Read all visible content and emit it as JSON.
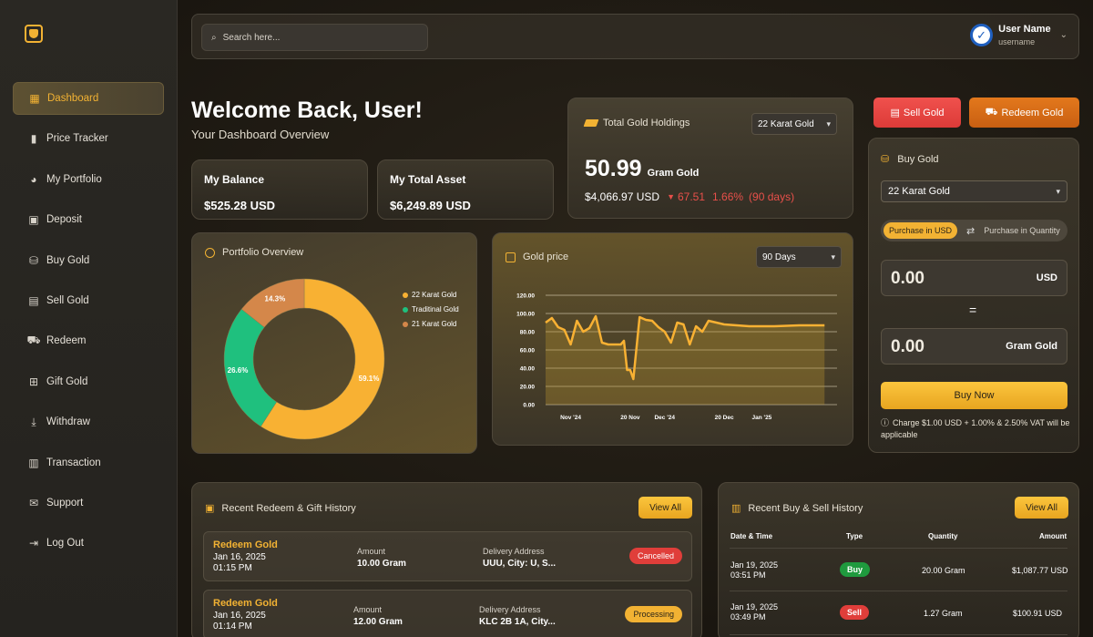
{
  "sidebar": {
    "items": [
      {
        "label": "Dashboard",
        "icon": "grid-icon",
        "glyph": "▦",
        "active": true
      },
      {
        "label": "Price Tracker",
        "icon": "bar-chart-icon",
        "glyph": "▮",
        "active": false
      },
      {
        "label": "My Portfolio",
        "icon": "pie-chart-icon",
        "glyph": "◕",
        "active": false
      },
      {
        "label": "Deposit",
        "icon": "deposit-icon",
        "glyph": "▣",
        "active": false
      },
      {
        "label": "Buy Gold",
        "icon": "cart-icon",
        "glyph": "⛁",
        "active": false
      },
      {
        "label": "Sell Gold",
        "icon": "sell-icon",
        "glyph": "▤",
        "active": false
      },
      {
        "label": "Redeem",
        "icon": "truck-icon",
        "glyph": "⛟",
        "active": false
      },
      {
        "label": "Gift Gold",
        "icon": "gift-icon",
        "glyph": "⊞",
        "active": false
      },
      {
        "label": "Withdraw",
        "icon": "withdraw-icon",
        "glyph": "⤓",
        "active": false
      },
      {
        "label": "Transaction",
        "icon": "receipt-icon",
        "glyph": "▥",
        "active": false
      },
      {
        "label": "Support",
        "icon": "mail-icon",
        "glyph": "✉",
        "active": false
      },
      {
        "label": "Log Out",
        "icon": "logout-icon",
        "glyph": "⇥",
        "active": false
      }
    ]
  },
  "topbar": {
    "search_placeholder": "Search here...",
    "user_name": "User Name",
    "user_handle": "username"
  },
  "welcome": {
    "title": "Welcome Back, User!",
    "subtitle": "Your Dashboard Overview"
  },
  "stats": {
    "balance_label": "My Balance",
    "balance_value": "$525.28 USD",
    "asset_label": "My Total Asset",
    "asset_value": "$6,249.89 USD"
  },
  "holdings": {
    "title": "Total Gold Holdings",
    "karat": "22 Karat Gold",
    "amount": "50.99",
    "unit": "Gram Gold",
    "usd": "$4,066.97 USD",
    "change": "67.51",
    "change_pct": "1.66%",
    "period": "(90 days)"
  },
  "actions": {
    "sell": "Sell Gold",
    "redeem": "Redeem Gold"
  },
  "buy": {
    "title": "Buy Gold",
    "karat": "22 Karat Gold",
    "toggle_on": "Purchase in USD",
    "toggle_off": "Purchase in Quantity",
    "usd_value": "0.00",
    "usd_unit": "USD",
    "equals": "=",
    "gram_value": "0.00",
    "gram_unit": "Gram Gold",
    "button": "Buy Now",
    "note": "Charge $1.00 USD + 1.00% & 2.50% VAT will be applicable"
  },
  "portfolio": {
    "title": "Portfolio Overview"
  },
  "gold_price": {
    "title": "Gold price",
    "range": "90 Days"
  },
  "chart_data": [
    {
      "type": "pie",
      "categories": [
        "22 Karat Gold",
        "Traditinal Gold",
        "21 Karat Gold"
      ],
      "values": [
        59.1,
        26.6,
        14.3
      ],
      "labels": [
        "59.1%",
        "26.6%",
        "14.3%"
      ],
      "colors": [
        "#f8b133",
        "#1fc07e",
        "#d4874a"
      ],
      "legend": "right"
    },
    {
      "type": "line",
      "x": [
        "2024-10-24",
        "2024-10-26",
        "2024-10-28",
        "2024-10-30",
        "2024-11-01",
        "2024-11-03",
        "2024-11-05",
        "2024-11-07",
        "2024-11-09",
        "2024-11-11",
        "2024-11-13",
        "2024-11-15",
        "2024-11-17",
        "2024-11-18",
        "2024-11-19",
        "2024-11-20",
        "2024-11-21",
        "2024-11-23",
        "2024-11-25",
        "2024-11-27",
        "2024-11-29",
        "2024-12-01",
        "2024-12-03",
        "2024-12-05",
        "2024-12-07",
        "2024-12-09",
        "2024-12-11",
        "2024-12-13",
        "2024-12-15",
        "2024-12-20",
        "2024-12-28",
        "2025-01-05",
        "2025-01-13",
        "2025-01-21"
      ],
      "y": [
        90,
        95,
        85,
        82,
        66,
        92,
        80,
        84,
        97,
        68,
        66,
        66,
        66,
        70,
        38,
        38,
        28,
        96,
        93,
        92,
        85,
        80,
        68,
        90,
        88,
        66,
        86,
        80,
        92,
        88,
        86,
        86,
        87,
        87
      ],
      "xticks": [
        "Nov '24",
        "20 Nov",
        "Dec '24",
        "20 Dec",
        "Jan '25"
      ],
      "xtick_dates": [
        "2024-11-01",
        "2024-11-20",
        "2024-12-01",
        "2024-12-20",
        "2025-01-01"
      ],
      "yticks": [
        "0.00",
        "20.00",
        "40.00",
        "60.00",
        "80.00",
        "100.00",
        "120.00"
      ],
      "ylim": [
        0,
        120
      ],
      "xlim": [
        "2024-10-24",
        "2025-01-25"
      ],
      "grid": true,
      "color": "#f8b133"
    }
  ],
  "redeem_history": {
    "title": "Recent Redeem & Gift History",
    "view_all": "View All",
    "amount_label": "Amount",
    "address_label": "Delivery Address",
    "rows": [
      {
        "title": "Redeem Gold",
        "date": "Jan 16, 2025",
        "time": "01:15 PM",
        "amount": "10.00 Gram",
        "address": "UUU, City: U, S...",
        "status": "Cancelled"
      },
      {
        "title": "Redeem Gold",
        "date": "Jan 16, 2025",
        "time": "01:14 PM",
        "amount": "12.00 Gram",
        "address": "KLC 2B 1A, City...",
        "status": "Processing"
      }
    ]
  },
  "trade_history": {
    "title": "Recent Buy & Sell History",
    "view_all": "View All",
    "headers": [
      "Date & Time",
      "Type",
      "Quantity",
      "Amount"
    ],
    "rows": [
      {
        "date": "Jan 19, 2025",
        "time": "03:51 PM",
        "type": "Buy",
        "quantity": "20.00 Gram",
        "amount": "$1,087.77 USD"
      },
      {
        "date": "Jan 19, 2025",
        "time": "03:49 PM",
        "type": "Sell",
        "quantity": "1.27 Gram",
        "amount": "$100.91 USD"
      }
    ]
  },
  "colors": {
    "accent": "#f2b233",
    "danger": "#e8504a",
    "success": "#1fc07e",
    "redeem": "#d8691a"
  }
}
